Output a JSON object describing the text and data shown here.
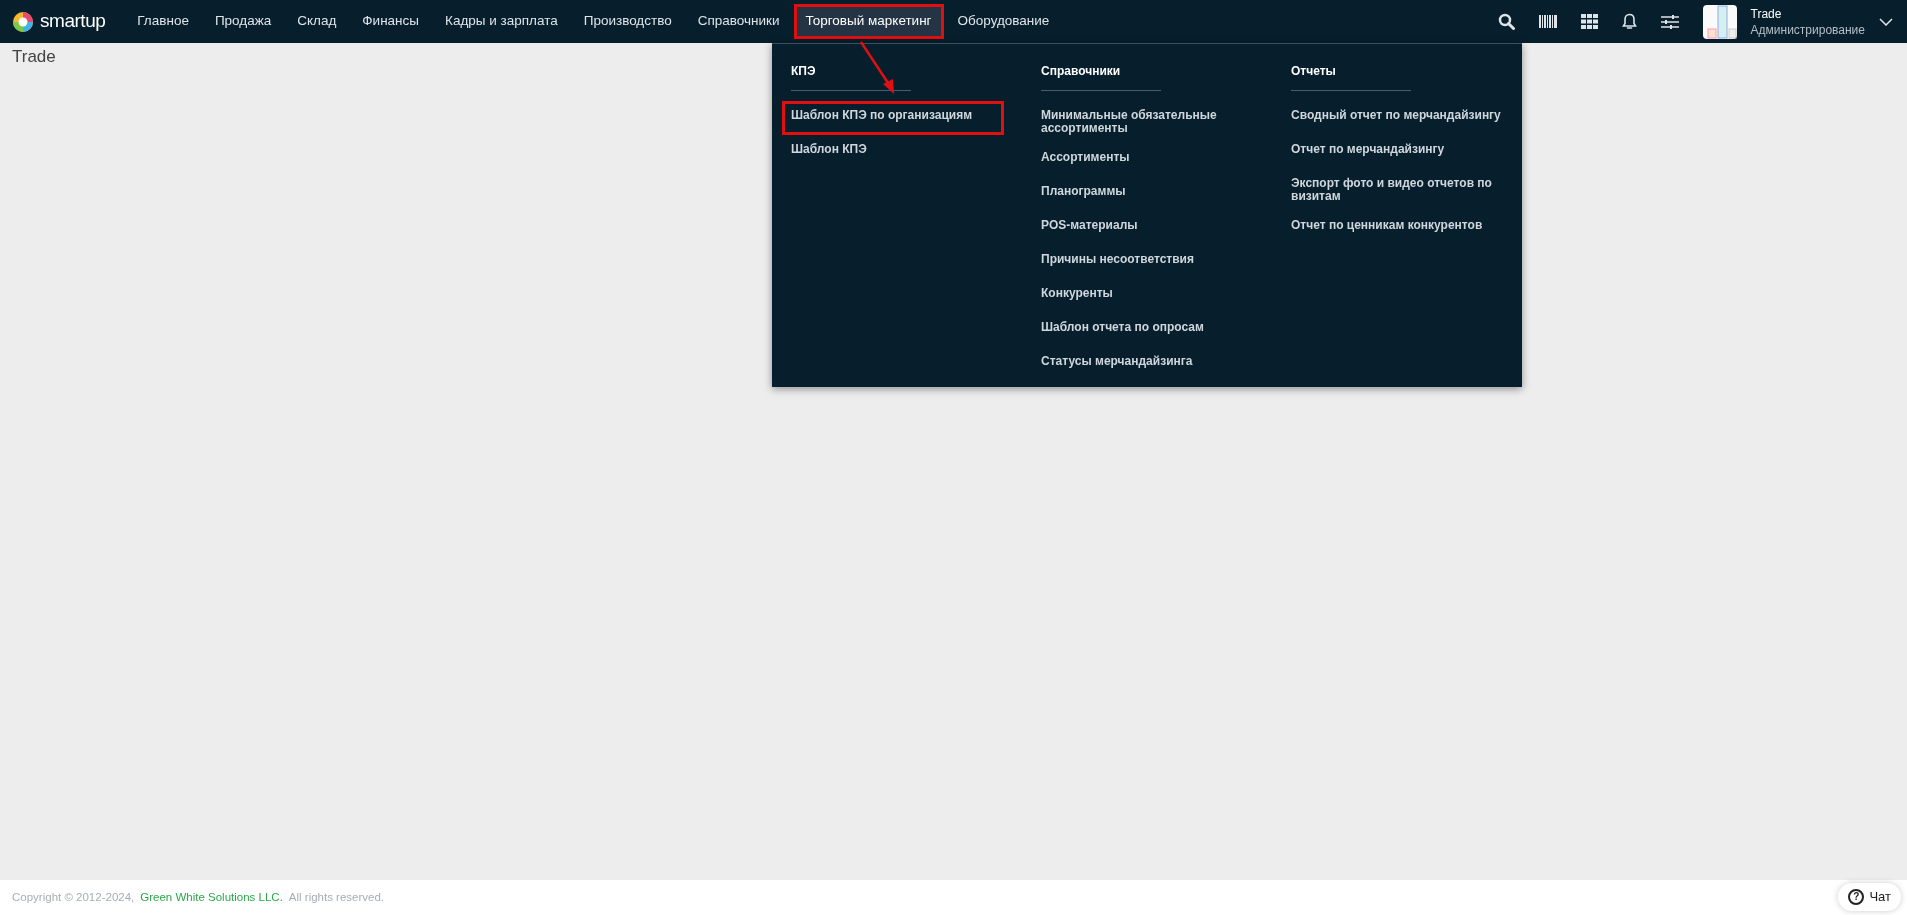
{
  "logo": {
    "text": "smartup"
  },
  "nav": [
    {
      "label": "Главное",
      "selected": false,
      "highlighted": false
    },
    {
      "label": "Продажа",
      "selected": false,
      "highlighted": false
    },
    {
      "label": "Склад",
      "selected": false,
      "highlighted": false
    },
    {
      "label": "Финансы",
      "selected": false,
      "highlighted": false
    },
    {
      "label": "Кадры и зарплата",
      "selected": false,
      "highlighted": false
    },
    {
      "label": "Производство",
      "selected": false,
      "highlighted": false
    },
    {
      "label": "Справочники",
      "selected": false,
      "highlighted": false
    },
    {
      "label": "Торговый маркетинг",
      "selected": true,
      "highlighted": true
    },
    {
      "label": "Оборудование",
      "selected": false,
      "highlighted": false
    }
  ],
  "user": {
    "name": "Trade",
    "role": "Администрирование"
  },
  "page_title": "Trade",
  "menu": {
    "columns": [
      {
        "heading": "КПЭ",
        "items": [
          {
            "label": "Шаблон КПЭ по организациям",
            "highlighted": true
          },
          {
            "label": "Шаблон КПЭ",
            "highlighted": false
          }
        ]
      },
      {
        "heading": "Справочники",
        "items": [
          {
            "label": "Минимальные обязательные ассортименты",
            "highlighted": false
          },
          {
            "label": "Ассортименты",
            "highlighted": false
          },
          {
            "label": "Планограммы",
            "highlighted": false
          },
          {
            "label": "POS-материалы",
            "highlighted": false
          },
          {
            "label": "Причины несоответствия",
            "highlighted": false
          },
          {
            "label": "Конкуренты",
            "highlighted": false
          },
          {
            "label": "Шаблон отчета по опросам",
            "highlighted": false
          },
          {
            "label": "Статусы мерчандайзинга",
            "highlighted": false
          }
        ]
      },
      {
        "heading": "Отчеты",
        "items": [
          {
            "label": "Сводный отчет по мерчандайзингу",
            "highlighted": false
          },
          {
            "label": "Отчет по мерчандайзингу",
            "highlighted": false
          },
          {
            "label": "Экспорт фото и видео отчетов по визитам",
            "highlighted": false
          },
          {
            "label": "Отчет по ценникам конкурентов",
            "highlighted": false
          }
        ]
      }
    ]
  },
  "footer": {
    "copyright": "Copyright © 2012-2024,",
    "company": "Green White Solutions LLC.",
    "rights": "All rights reserved."
  },
  "chat_button": {
    "label": "Чат",
    "icon": "?"
  }
}
